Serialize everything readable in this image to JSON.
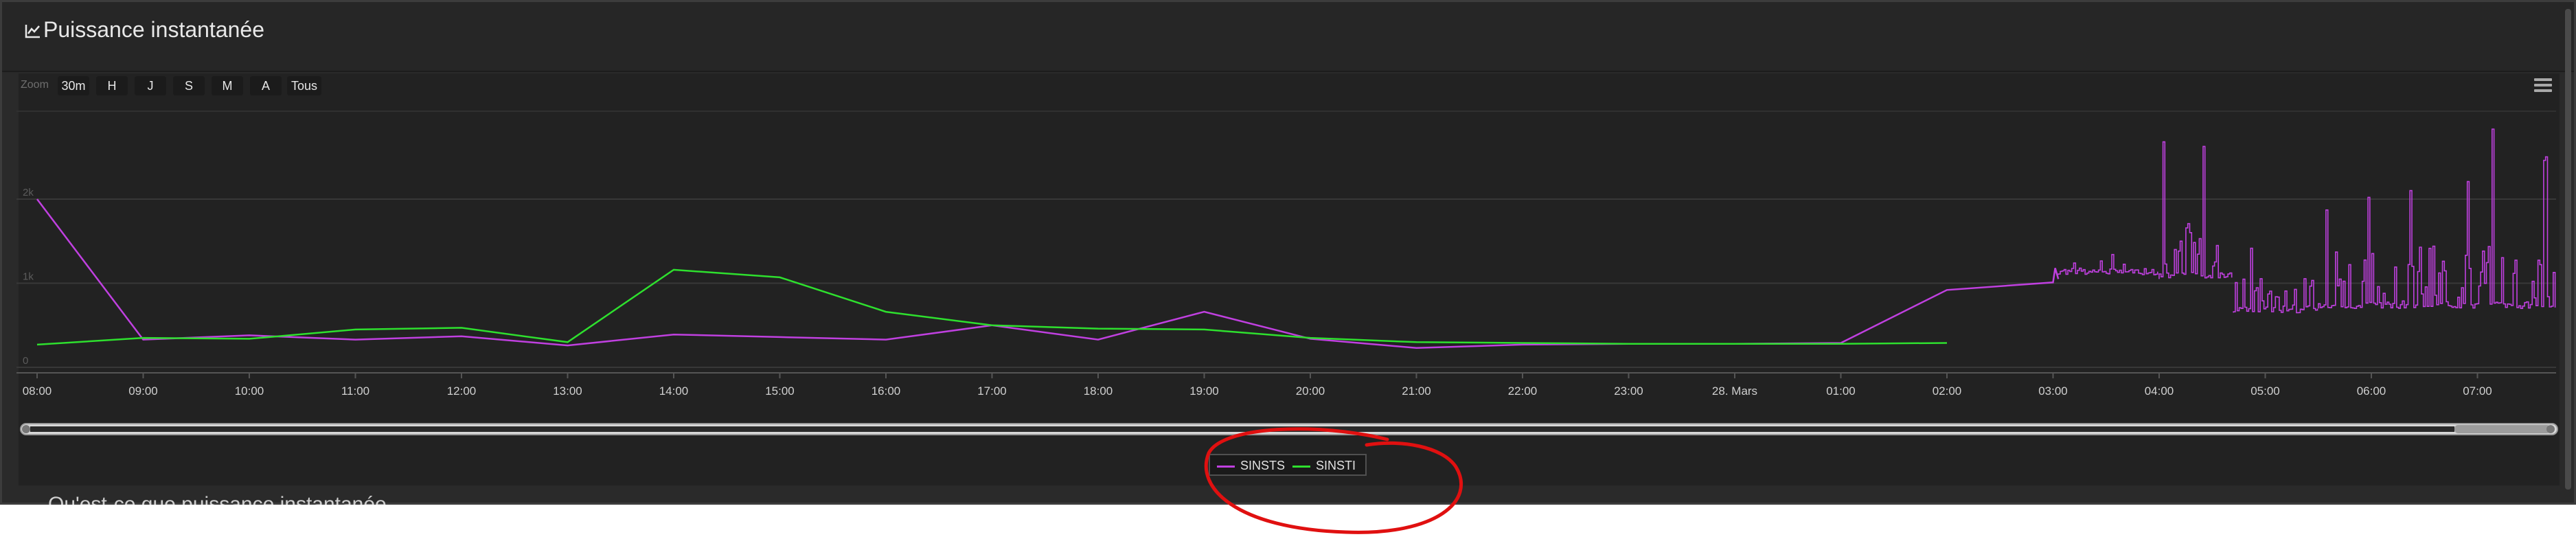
{
  "panel": {
    "title": "Puissance instantanée",
    "title_icon": "line-chart-icon",
    "next_section_title": "Qu'est-ce que puissance instantanée"
  },
  "toolbar": {
    "zoom_label": "Zoom",
    "buttons": [
      "30m",
      "H",
      "J",
      "S",
      "M",
      "A",
      "Tous"
    ],
    "menu_icon": "hamburger-menu-icon"
  },
  "legend": {
    "items": [
      {
        "name": "SINSTS",
        "color": "#c040e0"
      },
      {
        "name": "SINSTI",
        "color": "#2ee02e"
      }
    ]
  },
  "colors": {
    "background": "#2a2a2a",
    "plot_background": "#222222",
    "grid": "#333333",
    "annotation": "#e01010"
  },
  "chart_data": {
    "type": "line",
    "x_ticks": [
      "08:00",
      "09:00",
      "10:00",
      "11:00",
      "12:00",
      "13:00",
      "14:00",
      "15:00",
      "16:00",
      "17:00",
      "18:00",
      "19:00",
      "20:00",
      "21:00",
      "22:00",
      "23:00",
      "28. Mars",
      "01:00",
      "02:00",
      "03:00",
      "04:00",
      "05:00",
      "06:00",
      "07:00"
    ],
    "y_ticks": [
      "0",
      "1k",
      "2k"
    ],
    "ylim": [
      0,
      2900
    ],
    "x_unit": "hours since 08:00",
    "xlim": [
      -0.1,
      23.75
    ],
    "grid": true,
    "legend_position": "bottom-center",
    "series": [
      {
        "name": "SINSTS",
        "color": "#c040e0",
        "points": [
          [
            0,
            2000
          ],
          [
            1,
            330
          ],
          [
            2,
            380
          ],
          [
            3,
            330
          ],
          [
            4,
            370
          ],
          [
            5,
            260
          ],
          [
            6,
            390
          ],
          [
            7,
            360
          ],
          [
            8,
            330
          ],
          [
            9,
            500
          ],
          [
            10,
            330
          ],
          [
            11,
            660
          ],
          [
            12,
            340
          ],
          [
            13,
            230
          ],
          [
            14,
            270
          ],
          [
            15,
            280
          ],
          [
            16,
            280
          ],
          [
            17,
            290
          ],
          [
            18,
            920
          ],
          [
            19,
            1010
          ],
          [
            19.02,
            1180
          ],
          [
            19.05,
            1050
          ]
        ],
        "dense_segments": [
          {
            "x_start": 19.05,
            "x_end": 20.0,
            "base": 1100,
            "peak": 1350
          },
          {
            "x_start": 20.0,
            "x_end": 20.7,
            "base": 1050,
            "peak": 2950
          },
          {
            "x_start": 20.7,
            "x_end": 21.5,
            "base": 650,
            "peak": 1850
          },
          {
            "x_start": 21.5,
            "x_end": 23.75,
            "base": 700,
            "peak": 2850
          }
        ]
      },
      {
        "name": "SINSTI",
        "color": "#2ee02e",
        "points": [
          [
            0,
            270
          ],
          [
            1,
            350
          ],
          [
            2,
            340
          ],
          [
            3,
            450
          ],
          [
            4,
            470
          ],
          [
            5,
            300
          ],
          [
            6,
            1160
          ],
          [
            7,
            1070
          ],
          [
            8,
            660
          ],
          [
            9,
            500
          ],
          [
            10,
            460
          ],
          [
            11,
            450
          ],
          [
            12,
            350
          ],
          [
            13,
            300
          ],
          [
            14,
            290
          ],
          [
            15,
            280
          ],
          [
            16,
            280
          ],
          [
            17,
            280
          ],
          [
            18,
            290
          ]
        ]
      }
    ]
  }
}
